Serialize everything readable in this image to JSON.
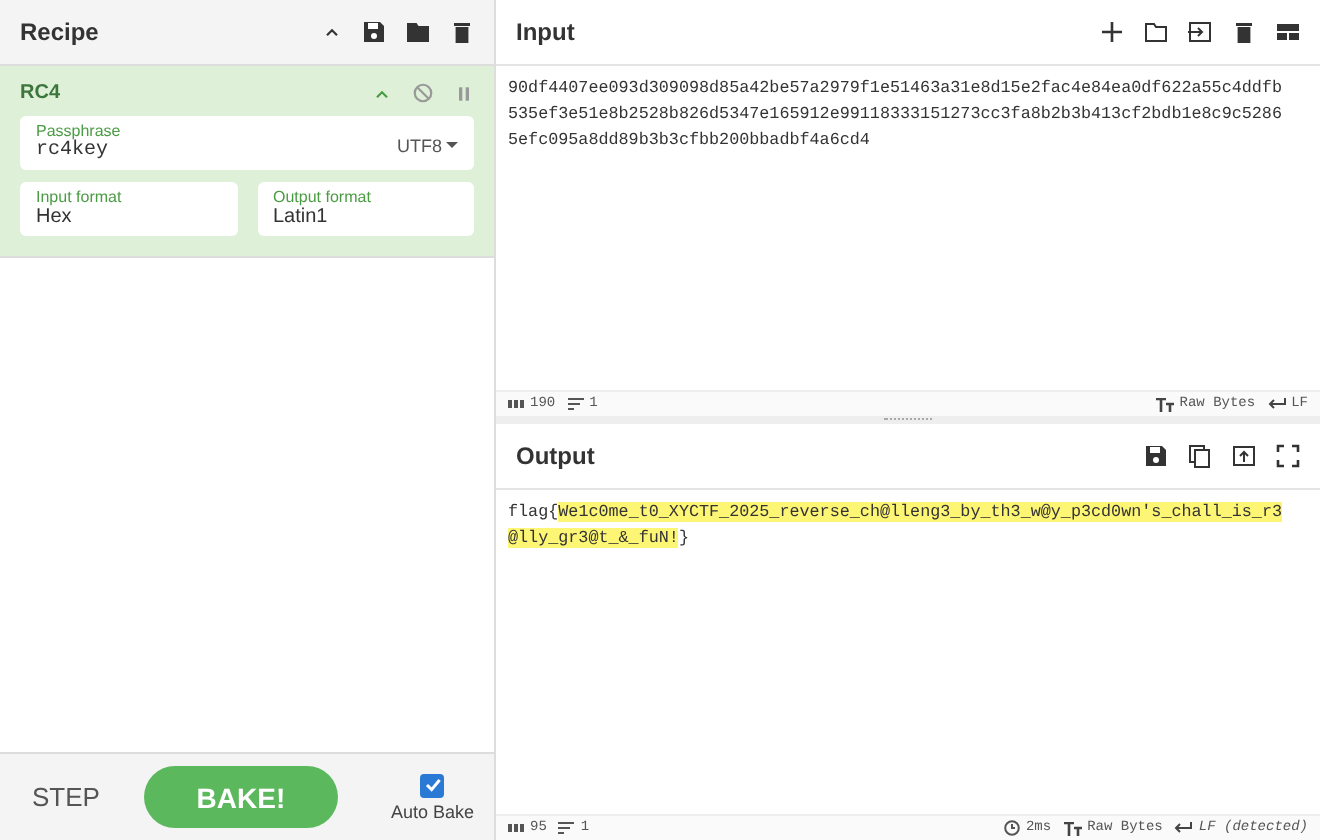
{
  "recipe": {
    "title": "Recipe"
  },
  "operation": {
    "name": "RC4",
    "fields": [
      {
        "kind": "passphrase",
        "label": "Passphrase",
        "value": "rc4key",
        "encoding": "UTF8"
      },
      {
        "kind": "text",
        "label": "Input format",
        "value": "Hex"
      },
      {
        "kind": "text",
        "label": "Output format",
        "value": "Latin1"
      }
    ]
  },
  "controls": {
    "step": "STEP",
    "bake": "BAKE!",
    "auto_bake": {
      "label": "Auto Bake",
      "checked": true
    }
  },
  "input": {
    "title": "Input",
    "text": "90df4407ee093d309098d85a42be57a2979f1e51463a31e8d15e2fac4e84ea0df622a55c4ddfb535ef3e51e8b2528b826d5347e165912e99118333151273cc3fa8b2b3b413cf2bdb1e8c9c52865efc095a8dd89b3b3cfbb200bbadbf4a6cd4",
    "status": {
      "length": "190",
      "lines": "1",
      "format": "Raw Bytes",
      "eol": "LF"
    }
  },
  "output": {
    "title": "Output",
    "segments": [
      {
        "text": "flag{",
        "highlighted": false
      },
      {
        "text": "We1c0me_t0_XYCTF_2025_reverse_ch@lleng3_by_th3_w@y_p3cd0wn's_chall_is_r3@lly_gr3@t_&_fuN!",
        "highlighted": true
      },
      {
        "text": "}",
        "highlighted": false
      }
    ],
    "status": {
      "length": "95",
      "lines": "1",
      "time": "2ms",
      "format": "Raw Bytes",
      "eol": "LF (detected)"
    }
  }
}
